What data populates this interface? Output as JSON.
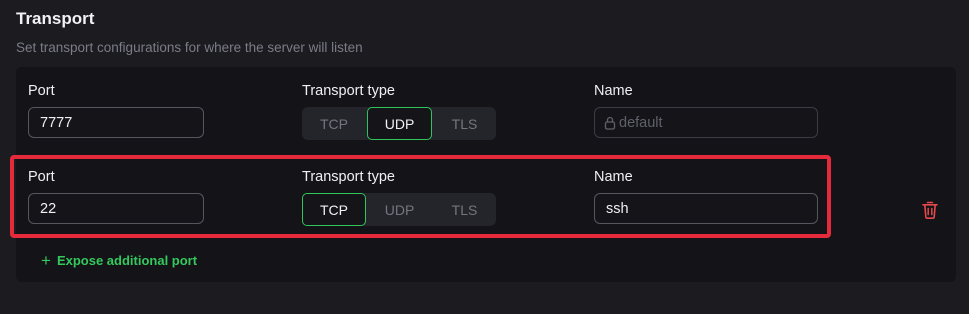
{
  "section": {
    "title": "Transport",
    "subtitle": "Set transport configurations for where the server will listen"
  },
  "labels": {
    "port": "Port",
    "transport_type": "Transport type",
    "name": "Name"
  },
  "transport_options": [
    "TCP",
    "UDP",
    "TLS"
  ],
  "rows": [
    {
      "port": "7777",
      "transport": "UDP",
      "name_placeholder": "default",
      "name_disabled": true,
      "icon": "lock-icon"
    },
    {
      "port": "22",
      "transport": "TCP",
      "name": "ssh",
      "delete_icon": "trash-icon"
    }
  ],
  "expose_button": "Expose additional port",
  "colors": {
    "accent": "#2fc55a",
    "danger": "#e5484d",
    "highlight": "#e52b3b",
    "panel": "#131318",
    "background": "#1b1b20"
  }
}
